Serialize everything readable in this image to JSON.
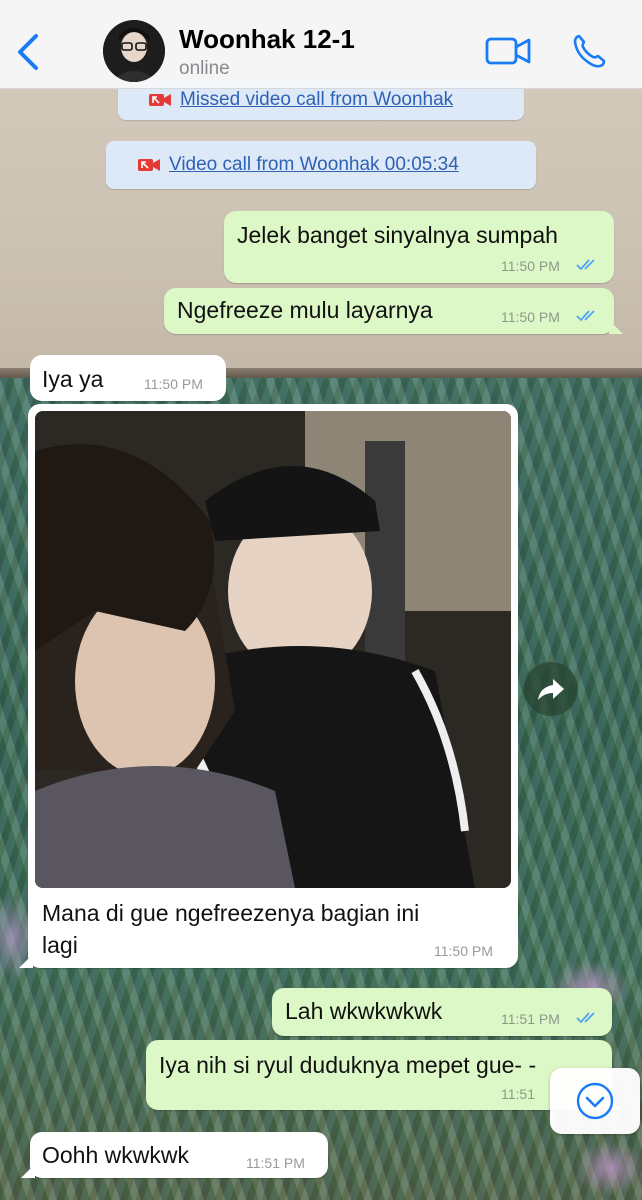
{
  "header": {
    "back_icon": "chevron-left-icon",
    "contact_name": "Woonhak 12-1",
    "status": "online",
    "video_icon": "video-camera-icon",
    "call_icon": "phone-icon"
  },
  "colors": {
    "accent": "#1a7cf5",
    "outgoing_bubble": "#dcf8c6",
    "incoming_bubble": "#ffffff",
    "system_pill": "#dde9f7",
    "read_ticks": "#4fa3f7",
    "missed_call_red": "#e53935"
  },
  "messages": {
    "missed_call": "Missed video call from Woonhak",
    "video_call": "Video call from Woonhak 00:05:34",
    "m1": {
      "text": "Jelek banget sinyalnya sumpah",
      "time": "11:50 PM"
    },
    "m2": {
      "text": "Ngefreeze mulu layarnya",
      "time": "11:50 PM"
    },
    "m3": {
      "text": "Iya ya",
      "time": "11:50 PM"
    },
    "m4": {
      "caption_line1": "Mana di gue ngefreezenya bagian ini",
      "caption_line2": "lagi",
      "time": "11:50 PM"
    },
    "m5": {
      "text": "Lah wkwkwkwk",
      "time": "11:51 PM"
    },
    "m6": {
      "text": "Iya nih si ryul duduknya mepet gue-  -",
      "time": "11:51"
    },
    "m7": {
      "text": "Oohh wkwkwk",
      "time": "11:51 PM"
    }
  },
  "icons": {
    "share": "share-forward-icon",
    "scroll_down": "chevron-down-circle-icon",
    "read_receipt": "double-check-icon"
  }
}
